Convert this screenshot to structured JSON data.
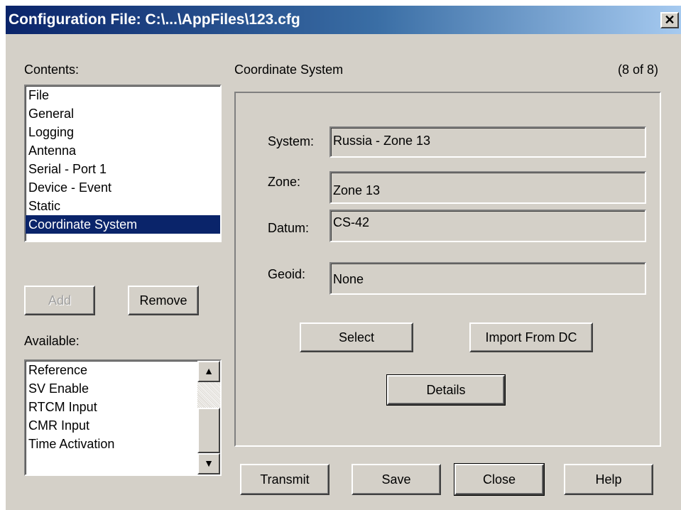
{
  "window": {
    "title": "Configuration File: C:\\...\\AppFiles\\123.cfg",
    "close_glyph": "✕"
  },
  "contents": {
    "label": "Contents:",
    "items": [
      "File",
      "General",
      "Logging",
      "Antenna",
      "Serial - Port 1",
      "Device - Event",
      "Static",
      "Coordinate System"
    ],
    "selected_index": 7
  },
  "buttons": {
    "add": "Add",
    "remove": "Remove",
    "select": "Select",
    "import_from_dc": "Import From DC",
    "details": "Details",
    "transmit": "Transmit",
    "save": "Save",
    "close": "Close",
    "help": "Help"
  },
  "available": {
    "label": "Available:",
    "items": [
      "Reference",
      "SV Enable",
      "RTCM Input",
      "CMR Input",
      "Time Activation"
    ],
    "scroll_up_icon": "▲",
    "scroll_down_icon": "▼"
  },
  "panel": {
    "title": "Coordinate System",
    "counter": "(8 of 8)",
    "fields": {
      "system_label": "System:",
      "system_value": "Russia - Zone 13",
      "zone_label": "Zone:",
      "zone_value": "Zone 13",
      "datum_label": "Datum:",
      "datum_value": "CS-42",
      "geoid_label": "Geoid:",
      "geoid_value": "None"
    }
  },
  "colors": {
    "titlebar_start": "#0a246a",
    "titlebar_end": "#a6caf0",
    "selection": "#0a246a",
    "face": "#d4d0c8"
  }
}
